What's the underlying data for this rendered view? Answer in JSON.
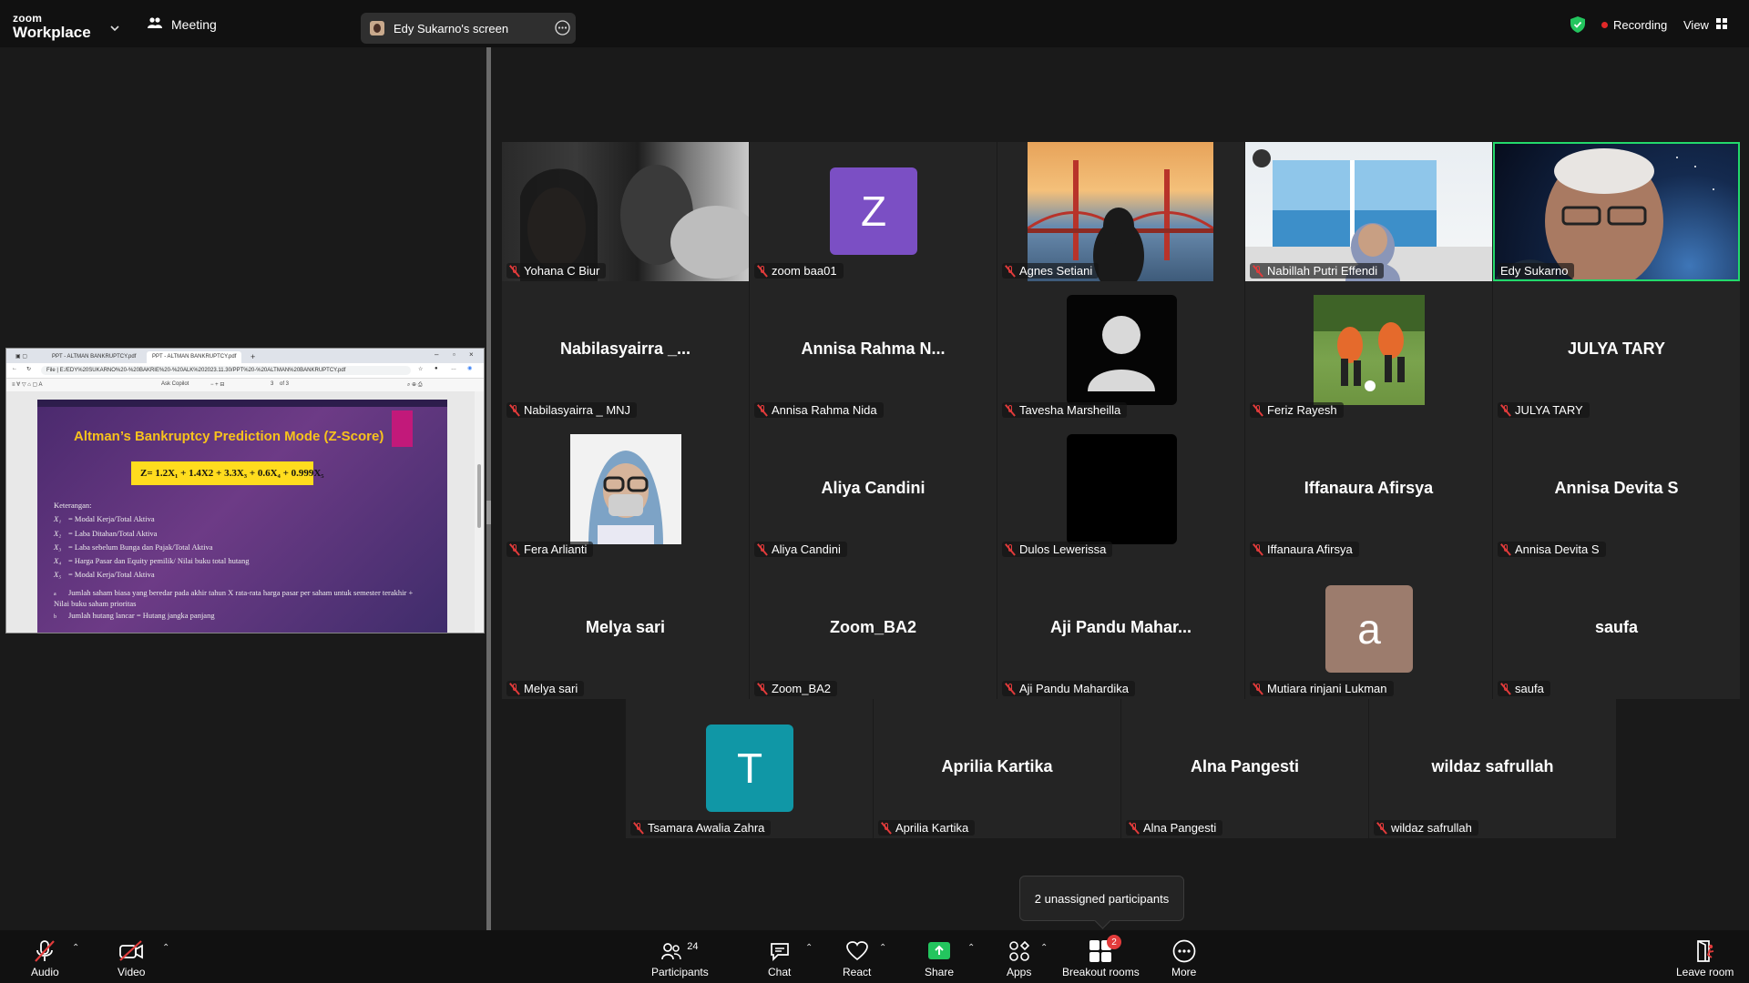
{
  "app": {
    "logo_line1": "zoom",
    "logo_line2": "Workplace",
    "meeting_label": "Meeting",
    "screen_share_label": "Edy Sukarno's screen",
    "recording_label": "Recording",
    "view_label": "View"
  },
  "shared_screen": {
    "tab1": "PPT - ALTMAN BANKRUPTCY.pdf",
    "tab2": "PPT - ALTMAN BANKRUPTCY.pdf",
    "address": "E:/EDY%20SUKARNO%20-%20BAKRIE%20-%20ALK%202023.11.30/PPT%20-%20ALTMAN%20BANKRUPTCY.pdf",
    "file_label": "File",
    "copilot": "Ask Copilot",
    "page_num": "3",
    "page_total": "of 3",
    "slide_title": "Altman’s Bankruptcy Prediction Mode (Z-Score)",
    "formula": "Z=   1.2X₁ + 1.4X2 + 3.3X₃ + 0.6X₄ + 0.999X₅",
    "keterangan": "Keterangan:",
    "lines": [
      {
        "var": "X₁",
        "text": "= Modal Kerja/Total Aktiva"
      },
      {
        "var": "X₂",
        "text": "= Laba Ditahan/Total Aktiva"
      },
      {
        "var": "X₃",
        "text": "= Laba sebelum Bunga dan Pajak/Total Aktiva"
      },
      {
        "var": "X₄",
        "text": "= Harga Pasar dan Equity pemilik/ Nilai buku total hutang"
      },
      {
        "var": "X₅",
        "text": "= Modal Kerja/Total Aktiva"
      }
    ],
    "note_a_bullet": "a",
    "note_a": "Jumlah saham biasa yang beredar pada akhir tahun X rata-rata harga pasar per saham untuk semester terakhir + Nilai buku saham prioritas",
    "note_b_bullet": "b",
    "note_b": "Jumlah hutang lancar = Hutang jangka panjang"
  },
  "participants": [
    {
      "name": "Yohana C Biur",
      "display": ""
    },
    {
      "name": "zoom baa01",
      "display": "",
      "avatar_letter": "Z"
    },
    {
      "name": "Agnes Setiani",
      "display": ""
    },
    {
      "name": "Nabillah Putri Effendi",
      "display": ""
    },
    {
      "name": "Edy Sukarno",
      "display": ""
    },
    {
      "name": "Nabilasyairra _ MNJ",
      "display": "Nabilasyairra _..."
    },
    {
      "name": "Annisa Rahma Nida",
      "display": "Annisa Rahma N..."
    },
    {
      "name": "Tavesha Marsheilla",
      "display": ""
    },
    {
      "name": "Feriz Rayesh",
      "display": ""
    },
    {
      "name": "JULYA TARY",
      "display": "JULYA TARY"
    },
    {
      "name": "Fera Arlianti",
      "display": ""
    },
    {
      "name": "Aliya Candini",
      "display": "Aliya Candini"
    },
    {
      "name": "Dulos Lewerissa",
      "display": ""
    },
    {
      "name": "Iffanaura Afirsya",
      "display": "Iffanaura Afirsya"
    },
    {
      "name": "Annisa Devita S",
      "display": "Annisa Devita S"
    },
    {
      "name": "Melya sari",
      "display": "Melya sari"
    },
    {
      "name": "Zoom_BA2",
      "display": "Zoom_BA2"
    },
    {
      "name": "Aji Pandu Mahardika",
      "display": "Aji Pandu Mahar..."
    },
    {
      "name": "Mutiara rinjani Lukman",
      "display": "",
      "avatar_letter": "a"
    },
    {
      "name": "saufa",
      "display": "saufa"
    },
    {
      "name": "Tsamara Awalia Zahra",
      "display": "",
      "avatar_letter": "T"
    },
    {
      "name": "Aprilia Kartika",
      "display": "Aprilia Kartika"
    },
    {
      "name": "Alna Pangesti",
      "display": "Alna Pangesti"
    },
    {
      "name": "wildaz safrullah",
      "display": "wildaz safrullah"
    }
  ],
  "tooltip": "2 unassigned participants",
  "toolbar": {
    "audio": "Audio",
    "video": "Video",
    "participants": "Participants",
    "participants_count": "24",
    "chat": "Chat",
    "react": "React",
    "share": "Share",
    "apps": "Apps",
    "breakout": "Breakout rooms",
    "breakout_badge": "2",
    "more": "More",
    "leave": "Leave room"
  },
  "colors": {
    "active_speaker": "#23d96b",
    "share_green": "#23c55e",
    "muted_red": "#e23b3b",
    "avatar_z": "#7b4fc4",
    "avatar_a": "#9c7c6d",
    "avatar_t": "#1097a6",
    "formula_yellow": "#ffdc1e"
  }
}
